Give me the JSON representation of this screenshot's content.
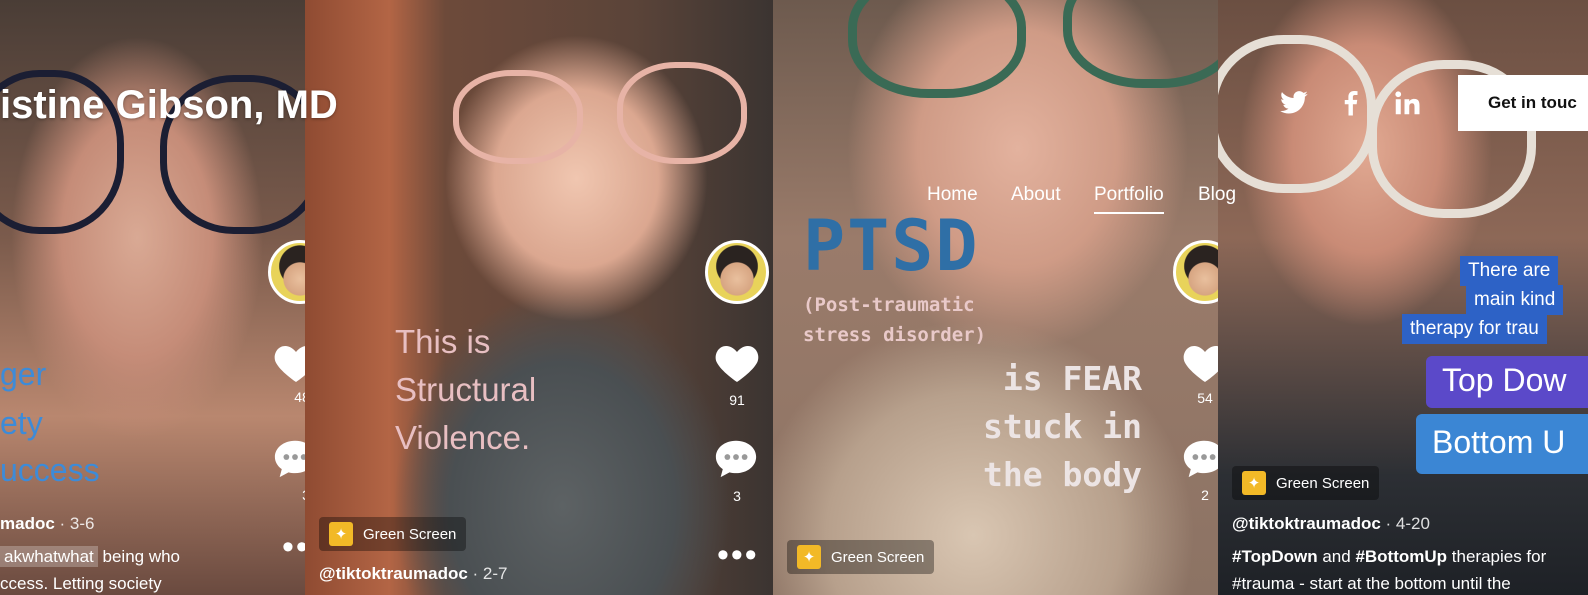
{
  "header": {
    "site_title": "istine Gibson, MD",
    "nav": [
      "Home",
      "About",
      "Portfolio",
      "Blog"
    ],
    "active_nav": "Portfolio",
    "social_icons": [
      "twitter-icon",
      "facebook-icon",
      "linkedin-icon"
    ],
    "cta_label": "Get in touc"
  },
  "panels": [
    {
      "overlay_lines": [
        "ger",
        "ety",
        "uccess"
      ],
      "likes": "48",
      "comments": "3",
      "handle": "madoc",
      "date": " · 3-6",
      "caption_tag": "akwhatwhat",
      "caption_rest": " being who",
      "caption_line2": "ccess. Letting society"
    },
    {
      "overlay_text": "This is\nStructural\nViolence.",
      "likes": "91",
      "comments": "3",
      "effect": "Green Screen",
      "handle": "@tiktoktraumadoc",
      "date": " · 2-7"
    },
    {
      "headline": "PTSD",
      "subline": "(Post-traumatic\nstress disorder)",
      "body": "is FEAR\nstuck in\nthe body",
      "likes": "54",
      "comments": "2",
      "effect": "Green Screen"
    },
    {
      "boxes": [
        "There are",
        "main kind",
        "therapy for trau"
      ],
      "pill_top": "Top Dow",
      "pill_bottom": "Bottom U",
      "effect": "Green Screen",
      "handle": "@tiktoktraumadoc",
      "date": " · 4-20",
      "caption_tag1": "#TopDown",
      "caption_mid": " and ",
      "caption_tag2": "#BottomUp",
      "caption_rest": " therapies for",
      "caption_line2": "#trauma - start at the bottom until the"
    }
  ],
  "colors": {
    "blue_overlay": "#3d8bd8",
    "ptsd_blue": "#2f6fa6",
    "box_blue": "#2d62c6",
    "pill_purple": "#5b49c9",
    "pill_blue": "#3b86d4",
    "gs_yellow": "#f2b927"
  }
}
